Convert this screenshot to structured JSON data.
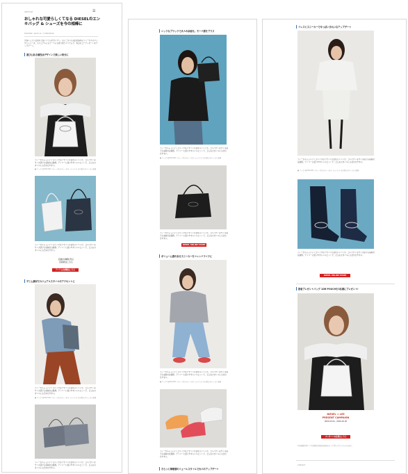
{
  "article": {
    "site_label": "ARTICLE",
    "title": "おしゃれな可愛らしくてなる DIESELのエンキバッグ & シューズを今の相棒に",
    "meta": "FASHION / 2023.11 / 3 MIN READ",
    "intro": "大切にしたい日常の上質アイテムをセレクト。今シーズンも注目を集めるディーゼルのバッグとシューズ。カジュアルにもモードにも寄り添うアイテムで、毎日のコーディネートをアップデート。",
    "credit": "Photo credit"
  },
  "sections": [
    {
      "heading": "遊び心ある個性派デザインで楽しい気分に"
    },
    {
      "heading": "デニム素材でカジュアルスタイルのアクセントに"
    },
    {
      "heading": "シックなブラックで大人の余裕を。モード感をプラス"
    },
    {
      "heading": "ボリューム感のあるスニーカーをトレンドライクに"
    },
    {
      "heading": "きらっと華奢感のミュールスタイルで大人のアップデート"
    },
    {
      "heading": "ドレスとスニーカーで今っぽいきれいなアップデート"
    },
    {
      "heading": "読者プレゼントバッグ 1DR-POUCHを3名様にプレゼント!"
    }
  ],
  "body_text": "ディーゼルらしいアイコニックなデザインが目を引くバッグ。コンパクトなサイズ感でも収納力は抜群。デイリーに使いやすいシルエットで、どんなスタイルにも合わせやすい。",
  "caption": "● バッグ 各¥00,000 / ディーゼル(ディーゼル ジャパン) その他スタイリスト私物",
  "buttons": {
    "shop_1": "アイテムの詳細はこちら",
    "shop_2": "DIESEL ONLINE STORE",
    "shop_3": "DIESEL ONLINE STORE",
    "present": "プレゼントの応募はこちら"
  },
  "promo": {
    "cta_text": "応募の詳細を見る\n応募者はこちら",
    "line1": "DIESEL × LEE",
    "line2": "PRESENT CAMPAIGN",
    "line3": "0000.00.00 - 0000.00.00"
  },
  "footer": {
    "notes": "※応募締め切り / ※当選者の発表は発送をもって代えさせていただきます。",
    "end": "CONTACT"
  }
}
